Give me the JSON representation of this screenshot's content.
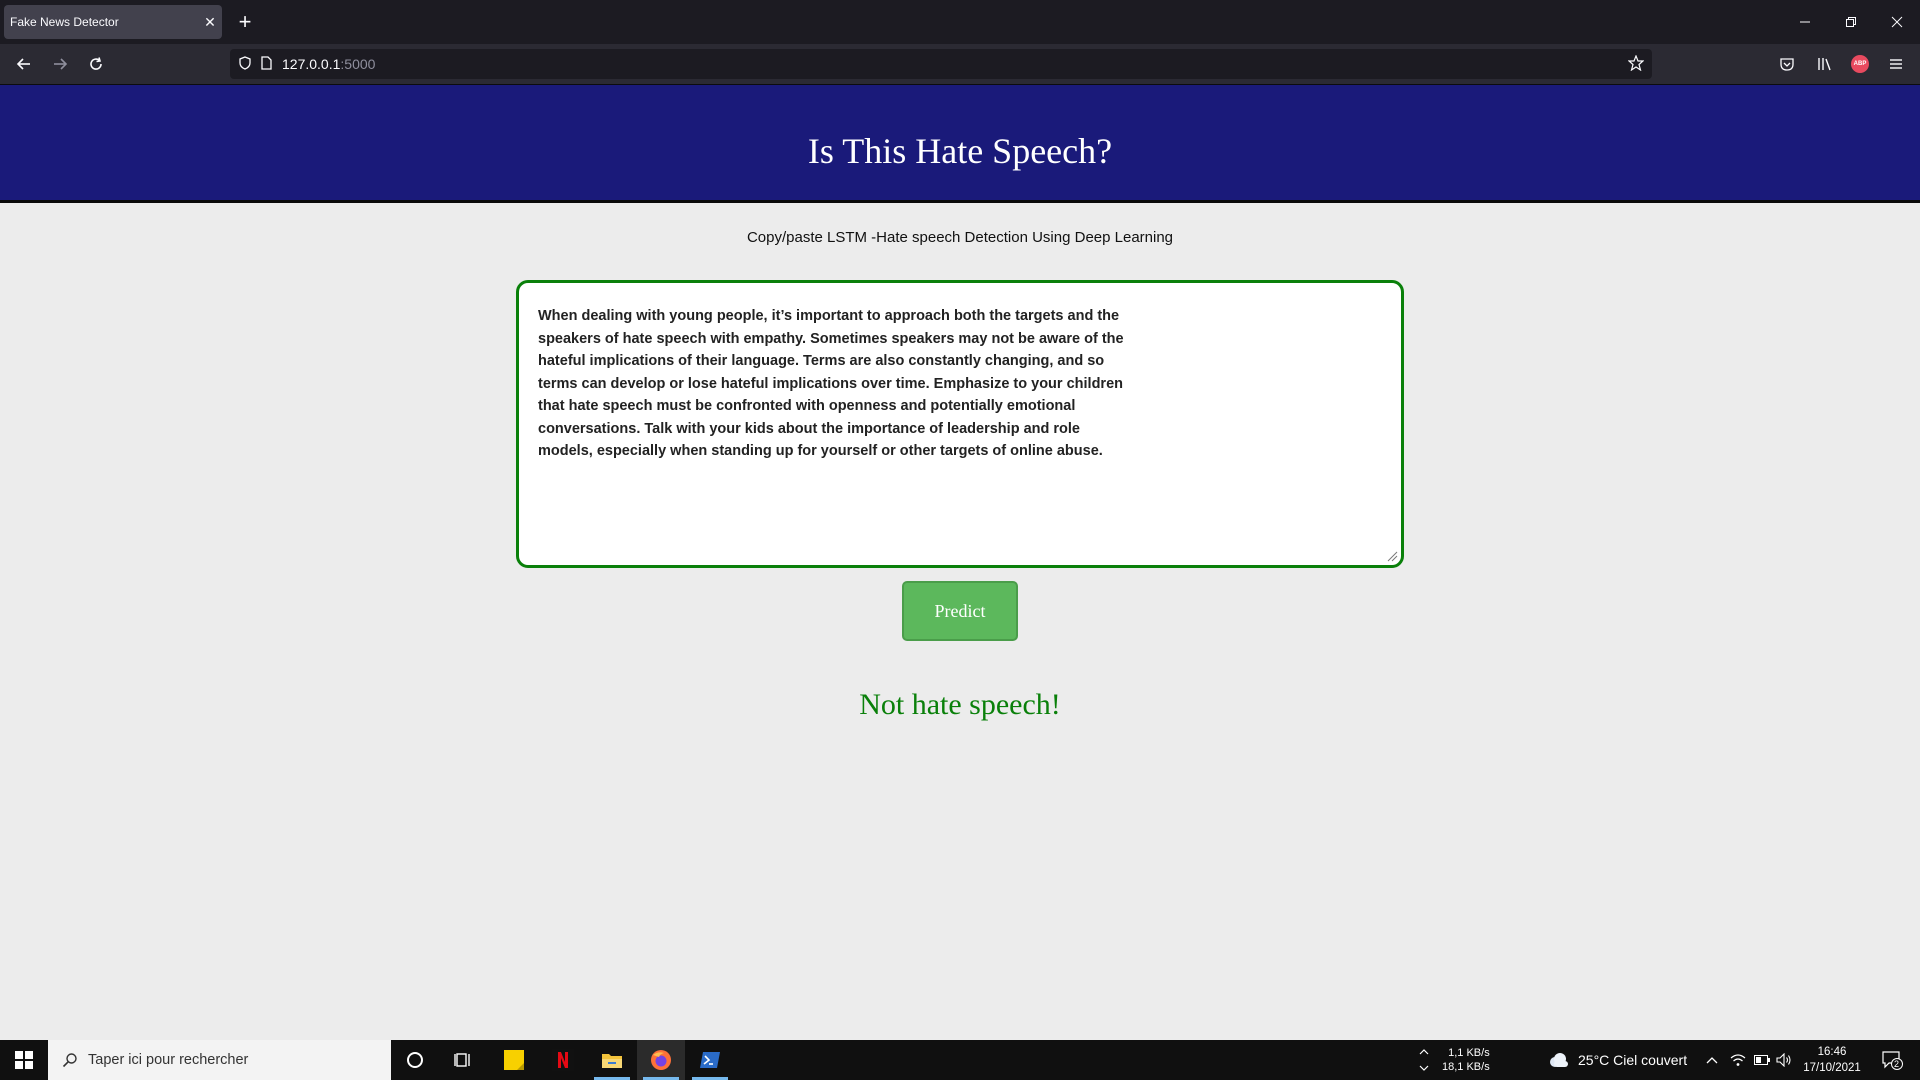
{
  "browser": {
    "tab_title": "Fake News Detector",
    "tab_close": "✕",
    "new_tab": "+",
    "url_host": "127.0.0.1",
    "url_port": ":5000",
    "window_controls": {
      "minimize": "—",
      "restore": "❐",
      "close": "✕"
    }
  },
  "page": {
    "title": "Is This Hate Speech?",
    "subtitle": "Copy/paste LSTM -Hate speech Detection Using Deep Learning",
    "input_text": "When dealing with young people, it’s important to approach both the targets and the speakers of hate speech with empathy. Sometimes speakers may not be aware of the hateful implications of their language. Terms are also constantly changing, and so terms can develop or lose hateful implications over time. Emphasize to your children that hate speech must be confronted with openness and potentially emotional conversations. Talk with your kids about the importance of leadership and role models, especially when standing up for yourself or other targets of online abuse.",
    "predict_label": "Predict",
    "result": "Not hate speech!",
    "colors": {
      "header_bg": "#1a1a7a",
      "button_bg": "#5cb85c",
      "result": "#0a800a",
      "textarea_border": "#0a800a"
    }
  },
  "taskbar": {
    "search_placeholder": "Taper ici pour rechercher",
    "net_up": "1,1 KB/s",
    "net_down": "18,1 KB/s",
    "weather": "25°C  Ciel couvert",
    "time": "16:46",
    "date": "17/10/2021",
    "notification_count": "2"
  }
}
